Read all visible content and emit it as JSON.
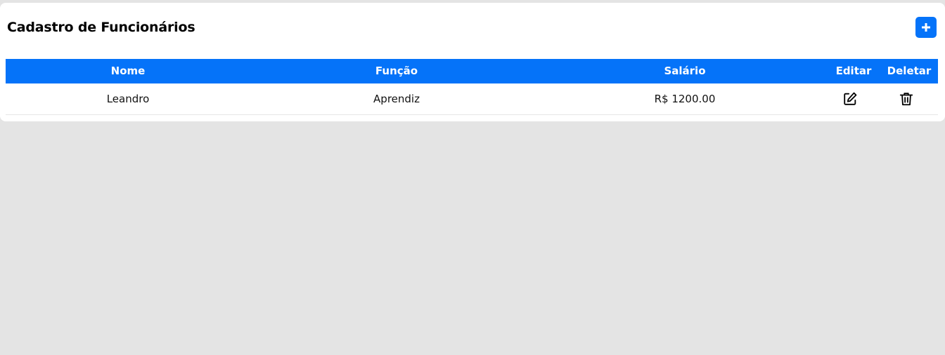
{
  "header": {
    "title": "Cadastro de Funcionários",
    "add_label": "+"
  },
  "table": {
    "columns": [
      "Nome",
      "Função",
      "Salário",
      "Editar",
      "Deletar"
    ],
    "rows": [
      {
        "nome": "Leandro",
        "funcao": "Aprendiz",
        "salario": "R$ 1200.00",
        "edit_icon": "edit-icon",
        "delete_icon": "trash-icon"
      }
    ]
  },
  "colors": {
    "accent": "#0573f9",
    "background": "#e4e4e4",
    "card": "#ffffff"
  }
}
